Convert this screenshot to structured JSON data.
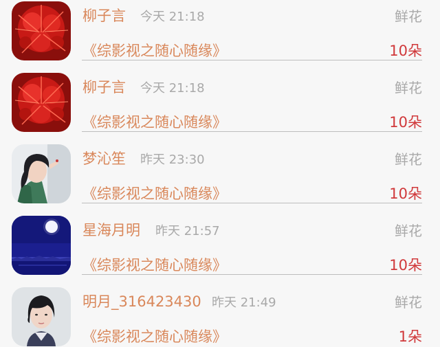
{
  "records": [
    {
      "avatar": "red-flower-avatar",
      "name": "柳子言",
      "time": "今天 21:18",
      "gift_type": "鲜花",
      "book": "《综影视之随心随缘》",
      "count": "10朵"
    },
    {
      "avatar": "red-flower-avatar",
      "name": "柳子言",
      "time": "今天 21:18",
      "gift_type": "鲜花",
      "book": "《综影视之随心随缘》",
      "count": "10朵"
    },
    {
      "avatar": "girl-portrait-avatar",
      "name": "梦沁笙",
      "time": "昨天 23:30",
      "gift_type": "鲜花",
      "book": "《综影视之随心随缘》",
      "count": "10朵"
    },
    {
      "avatar": "moon-night-avatar",
      "name": "星海月明",
      "time": "昨天 21:57",
      "gift_type": "鲜花",
      "book": "《综影视之随心随缘》",
      "count": "10朵"
    },
    {
      "avatar": "woman-portrait-avatar",
      "name": "明月_316423430",
      "time": "昨天 21:49",
      "gift_type": "鲜花",
      "book": "《综影视之随心随缘》",
      "count": "1朵"
    }
  ],
  "colors": {
    "name_text": "#d9875a",
    "meta_text": "#a9a9a9",
    "count_text": "#d0383a",
    "divider": "#bdbdbd",
    "background": "#f7f7f7"
  }
}
